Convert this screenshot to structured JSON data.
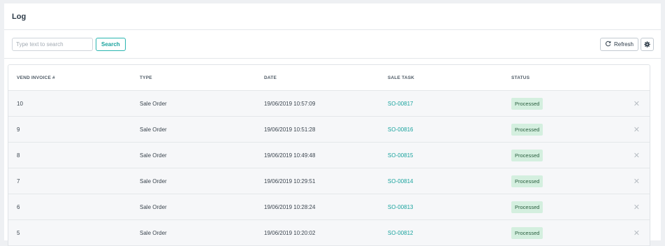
{
  "header": {
    "title": "Log"
  },
  "toolbar": {
    "search_placeholder": "Type text to search",
    "search_label": "Search",
    "refresh_label": "Refresh"
  },
  "table": {
    "columns": [
      "VEND INVOICE #",
      "TYPE",
      "DATE",
      "SALE TASK",
      "STATUS"
    ],
    "rows": [
      {
        "invoice": "10",
        "type": "Sale Order",
        "date": "19/06/2019 10:57:09",
        "task": "SO-00817",
        "status": "Processed"
      },
      {
        "invoice": "9",
        "type": "Sale Order",
        "date": "19/06/2019 10:51:28",
        "task": "SO-00816",
        "status": "Processed"
      },
      {
        "invoice": "8",
        "type": "Sale Order",
        "date": "19/06/2019 10:49:48",
        "task": "SO-00815",
        "status": "Processed"
      },
      {
        "invoice": "7",
        "type": "Sale Order",
        "date": "19/06/2019 10:29:51",
        "task": "SO-00814",
        "status": "Processed"
      },
      {
        "invoice": "6",
        "type": "Sale Order",
        "date": "19/06/2019 10:28:24",
        "task": "SO-00813",
        "status": "Processed"
      },
      {
        "invoice": "5",
        "type": "Sale Order",
        "date": "19/06/2019 10:20:02",
        "task": "SO-00812",
        "status": "Processed"
      }
    ]
  },
  "icons": {
    "refresh": "refresh-icon",
    "settings": "gear-icon",
    "remove": "close-icon"
  },
  "colors": {
    "accent": "#1aa39e",
    "badge_bg": "#d4efdf",
    "badge_text": "#2a5e3f"
  }
}
